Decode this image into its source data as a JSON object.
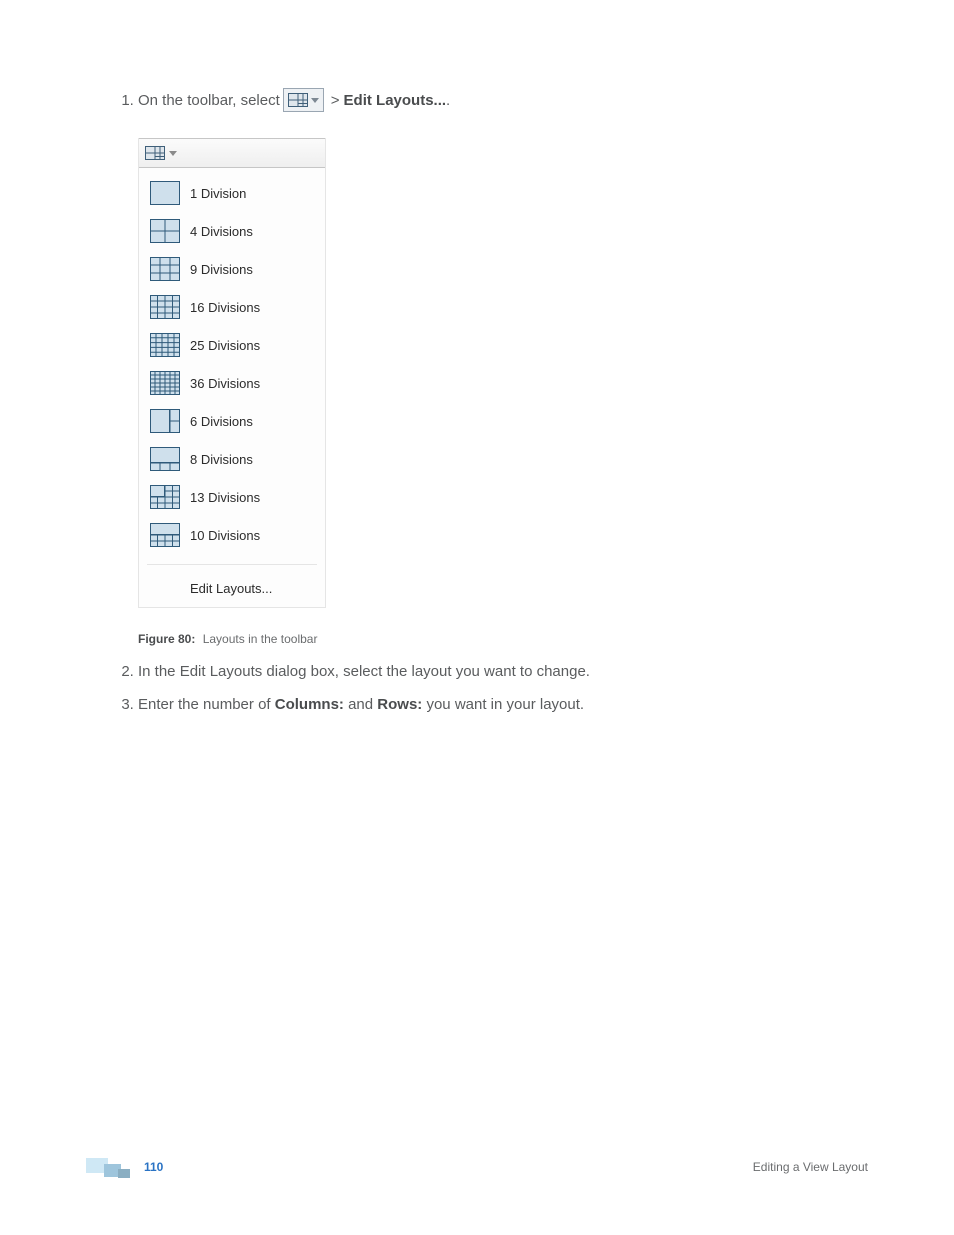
{
  "step1": {
    "prefix": "On the toolbar, select",
    "separator": ">",
    "bold": "Edit Layouts...",
    "suffix": "."
  },
  "dropdown": {
    "items": [
      {
        "label": "1 Division",
        "rows": 1,
        "cols": 1
      },
      {
        "label": "4 Divisions",
        "rows": 2,
        "cols": 2
      },
      {
        "label": "9 Divisions",
        "rows": 3,
        "cols": 3
      },
      {
        "label": "16 Divisions",
        "rows": 4,
        "cols": 4
      },
      {
        "label": "25 Divisions",
        "rows": 5,
        "cols": 5
      },
      {
        "label": "36 Divisions",
        "rows": 6,
        "cols": 6
      },
      {
        "label": "6 Divisions",
        "rows": 2,
        "cols": 3,
        "big": [
          0,
          0,
          2,
          2
        ]
      },
      {
        "label": "8 Divisions",
        "rows": 3,
        "cols": 3,
        "big": [
          0,
          0,
          2,
          3
        ]
      },
      {
        "label": "13 Divisions",
        "rows": 4,
        "cols": 4,
        "big": [
          0,
          0,
          2,
          2
        ]
      },
      {
        "label": "10 Divisions",
        "rows": 4,
        "cols": 4,
        "big": [
          0,
          0,
          2,
          4
        ]
      }
    ],
    "footer": "Edit Layouts..."
  },
  "figure": {
    "label": "Figure 80:",
    "caption": "Layouts in the toolbar"
  },
  "step2": "In the Edit Layouts dialog box, select the layout you want to change.",
  "step3": {
    "prefix": "Enter the number of ",
    "bold1": "Columns:",
    "mid": " and ",
    "bold2": "Rows:",
    "suffix": " you want in your layout."
  },
  "footer": {
    "page": "110",
    "title": "Editing a View Layout"
  }
}
